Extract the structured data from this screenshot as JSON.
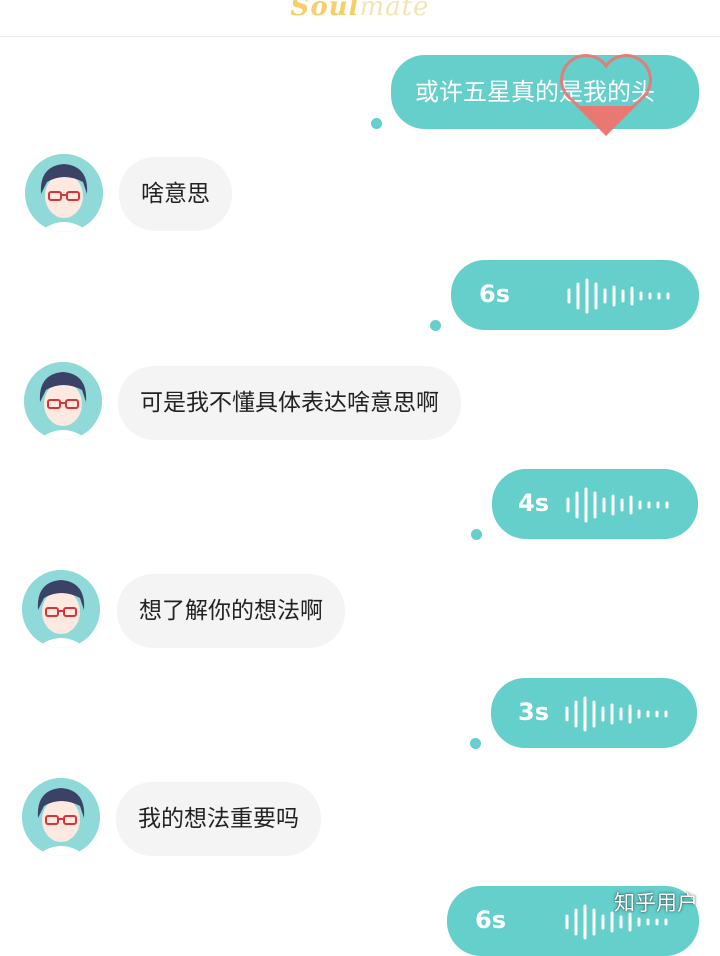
{
  "app": {
    "logo_part1": "Soul",
    "logo_part2": "mate"
  },
  "messages": [
    {
      "kind": "text-out",
      "text": "或许五星真的是我的头"
    },
    {
      "kind": "text-in",
      "text": "啥意思"
    },
    {
      "kind": "voice-out",
      "duration": "6s"
    },
    {
      "kind": "text-in",
      "text": "可是我不懂具体表达啥意思啊"
    },
    {
      "kind": "voice-out",
      "duration": "4s"
    },
    {
      "kind": "text-in",
      "text": "想了解你的想法啊"
    },
    {
      "kind": "voice-out",
      "duration": "3s"
    },
    {
      "kind": "text-in",
      "text": "我的想法重要吗"
    },
    {
      "kind": "voice-out",
      "duration": "6s"
    }
  ],
  "watermark": "知乎用户",
  "colors": {
    "accent": "#64cfcb",
    "incoming_bubble": "#f4f4f4",
    "heart": "#f0736e",
    "logo": "#f6cf6a"
  },
  "icons": {
    "heart": "heart-icon",
    "voice": "voice-wave-icon",
    "avatar": "anime-avatar"
  }
}
